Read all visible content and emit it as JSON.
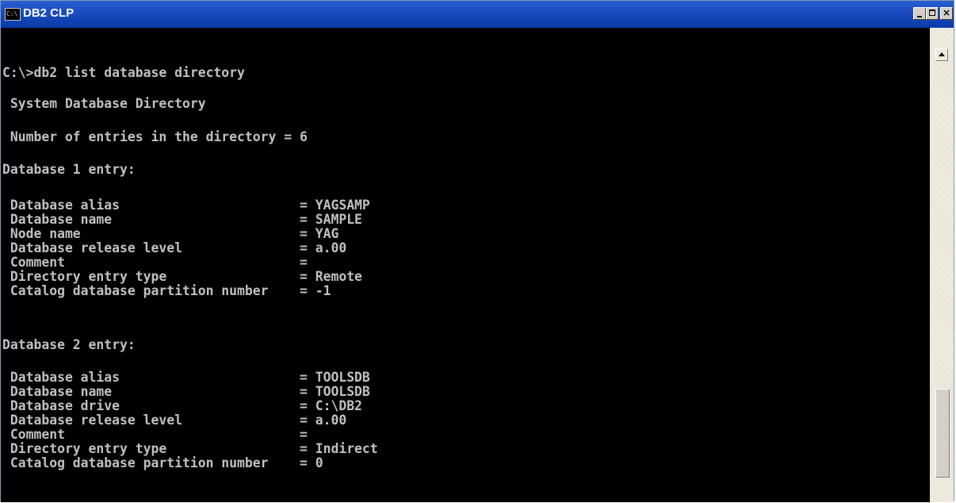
{
  "window": {
    "title": "DB2 CLP",
    "icon": "console-icon",
    "controls": {
      "minimize": "minimize-icon",
      "maximize": "maximize-icon",
      "close": "×"
    }
  },
  "console": {
    "lines": [
      "C:\\>db2 list database directory",
      " System Database Directory",
      " Number of entries in the directory = 6",
      "Database 1 entry:",
      " Database alias                       = YAGSAMP",
      " Database name                        = SAMPLE",
      " Node name                            = YAG",
      " Database release level               = a.00",
      " Comment                              =",
      " Directory entry type                 = Remote",
      " Catalog database partition number    = -1",
      "Database 2 entry:",
      " Database alias                       = TOOLSDB",
      " Database name                        = TOOLSDB",
      " Database drive                       = C:\\DB2",
      " Database release level               = a.00",
      " Comment                              =",
      " Directory entry type                 = Indirect",
      " Catalog database partition number    = 0"
    ]
  },
  "scrollbar": {
    "position": "bottom",
    "up_arrow": "up-arrow-icon"
  }
}
